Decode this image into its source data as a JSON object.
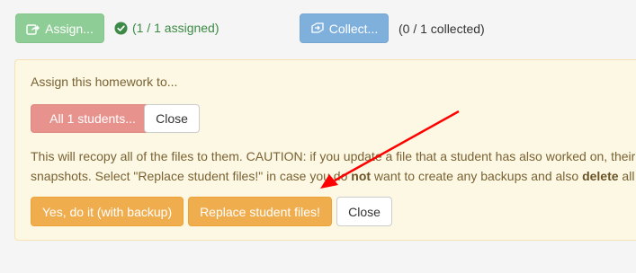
{
  "top": {
    "assign_label": "Assign...",
    "assigned_status": "(1 / 1 assigned)",
    "collect_label": "Collect...",
    "collected_status": "(0 / 1 collected)"
  },
  "panel": {
    "prompt": "Assign this homework to...",
    "all_students_label": "All 1 students...",
    "close_label": "Close",
    "caution_line1_a": "This will recopy all of the files to them. CAUTION: if you update a file that a student has also worked on, their",
    "caution_line2_a": "snapshots. Select \"Replace student files!\" in case you do ",
    "caution_line2_not": "not",
    "caution_line2_b": " want to create any backups and also ",
    "caution_line2_delete": "delete",
    "caution_line2_c": " all",
    "yes_label": "Yes, do it (with backup)",
    "replace_label": "Replace student files!",
    "close2_label": "Close"
  },
  "colors": {
    "assign_green": "#8fcd96",
    "collect_blue": "#7fb0dc",
    "danger_red": "#e8928d",
    "warning_orange": "#f0ad4e",
    "panel_bg": "#fcf8e3",
    "annotation_arrow": "#ff0000"
  },
  "icons": {
    "assign": "share-square-icon",
    "assigned_status": "check-circle-icon",
    "collect": "collect-icon",
    "annotation": "red-arrow-annotation"
  }
}
